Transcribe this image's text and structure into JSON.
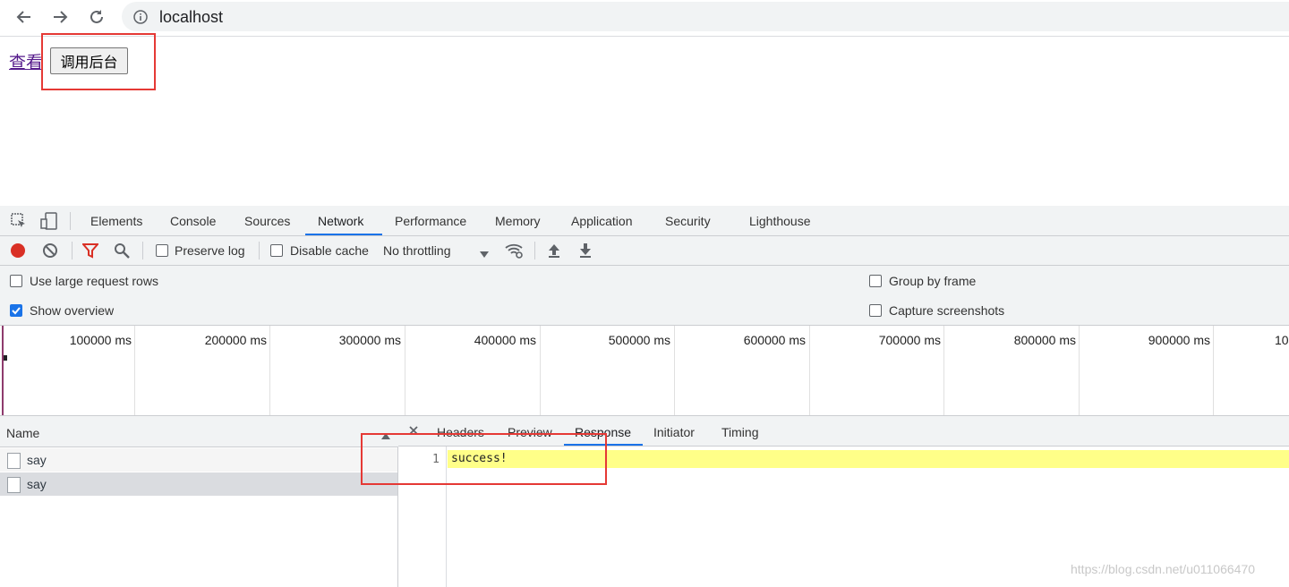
{
  "browser": {
    "url": "localhost"
  },
  "page": {
    "link_text": "查看",
    "button_label": "调用后台"
  },
  "devtools": {
    "tabs": [
      "Elements",
      "Console",
      "Sources",
      "Network",
      "Performance",
      "Memory",
      "Application",
      "Security",
      "Lighthouse"
    ],
    "active_tab": "Network",
    "toolbar": {
      "preserve_log": "Preserve log",
      "disable_cache": "Disable cache",
      "throttling": "No throttling"
    },
    "settings": {
      "large_rows": "Use large request rows",
      "show_overview": "Show overview",
      "group_by_frame": "Group by frame",
      "capture_screenshots": "Capture screenshots"
    },
    "overview_ticks": [
      "100000 ms",
      "200000 ms",
      "300000 ms",
      "400000 ms",
      "500000 ms",
      "600000 ms",
      "700000 ms",
      "800000 ms",
      "900000 ms",
      "10"
    ],
    "name_column": "Name",
    "requests": [
      "say",
      "say"
    ],
    "detail_tabs": [
      "Headers",
      "Preview",
      "Response",
      "Initiator",
      "Timing"
    ],
    "active_detail_tab": "Response",
    "response": {
      "line_number": "1",
      "body": "success!"
    }
  },
  "watermark": "https://blog.csdn.net/u011066470",
  "colors": {
    "accent": "#1a73e8",
    "highlight": "#ffff88",
    "annotation": "#e53935",
    "record": "#d93025"
  }
}
